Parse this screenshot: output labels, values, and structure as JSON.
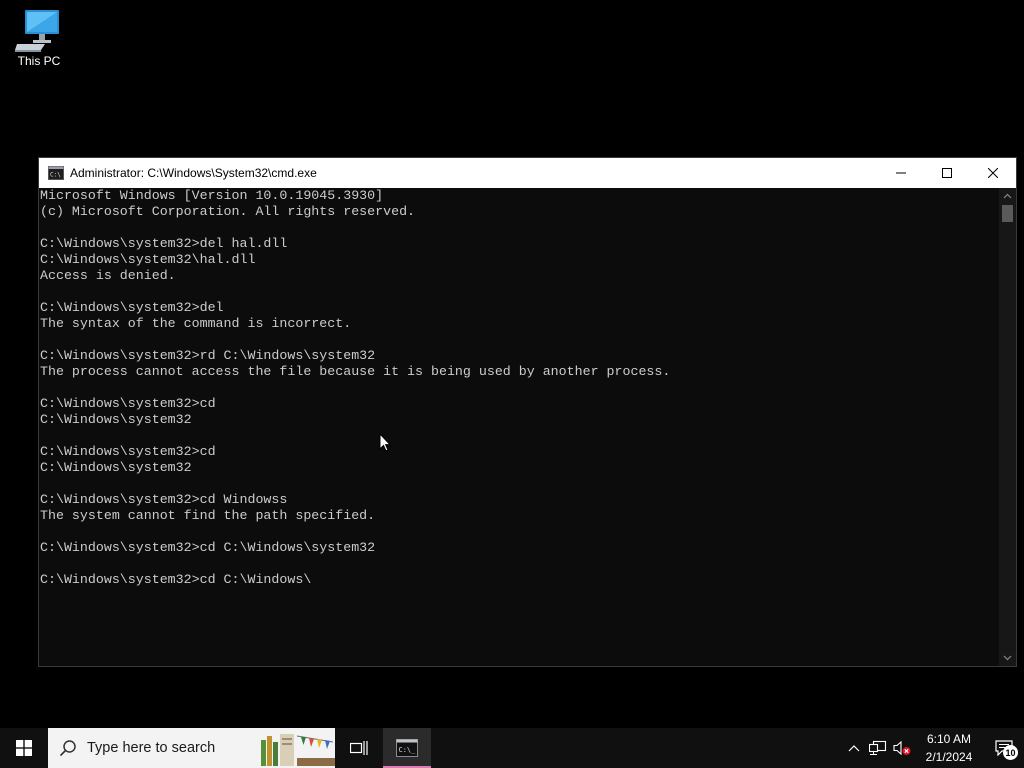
{
  "desktop": {
    "icons": [
      {
        "label": "This PC",
        "icon": "this-pc-icon"
      }
    ]
  },
  "cmd_window": {
    "title": "Administrator: C:\\Windows\\System32\\cmd.exe",
    "icon": "cmd-icon",
    "controls": {
      "minimize": "minimize-icon",
      "maximize": "maximize-icon",
      "close": "close-icon"
    },
    "console_lines": [
      "Microsoft Windows [Version 10.0.19045.3930]",
      "(c) Microsoft Corporation. All rights reserved.",
      "",
      "C:\\Windows\\system32>del hal.dll",
      "C:\\Windows\\system32\\hal.dll",
      "Access is denied.",
      "",
      "C:\\Windows\\system32>del",
      "The syntax of the command is incorrect.",
      "",
      "C:\\Windows\\system32>rd C:\\Windows\\system32",
      "The process cannot access the file because it is being used by another process.",
      "",
      "C:\\Windows\\system32>cd",
      "C:\\Windows\\system32",
      "",
      "C:\\Windows\\system32>cd",
      "C:\\Windows\\system32",
      "",
      "C:\\Windows\\system32>cd Windowss",
      "The system cannot find the path specified.",
      "",
      "C:\\Windows\\system32>cd C:\\Windows\\system32",
      "",
      "C:\\Windows\\system32>cd C:\\Windows\\"
    ]
  },
  "taskbar": {
    "start_icon": "windows-logo-icon",
    "search_placeholder": "Type here to search",
    "taskview_icon": "task-view-icon",
    "pinned_apps": [
      {
        "name": "Command Prompt",
        "icon": "cmd-icon",
        "active": true
      }
    ],
    "tray": {
      "icons": [
        "chevron-up-icon",
        "network-icon",
        "volume-muted-icon"
      ],
      "time": "6:10 AM",
      "date": "2/1/2024",
      "notification_count": "10"
    }
  },
  "colors": {
    "console_bg": "#0c0c0c",
    "console_text": "#cccccc",
    "taskbar_bg": "#101010",
    "active_app_indicator": "#e07ab4"
  }
}
